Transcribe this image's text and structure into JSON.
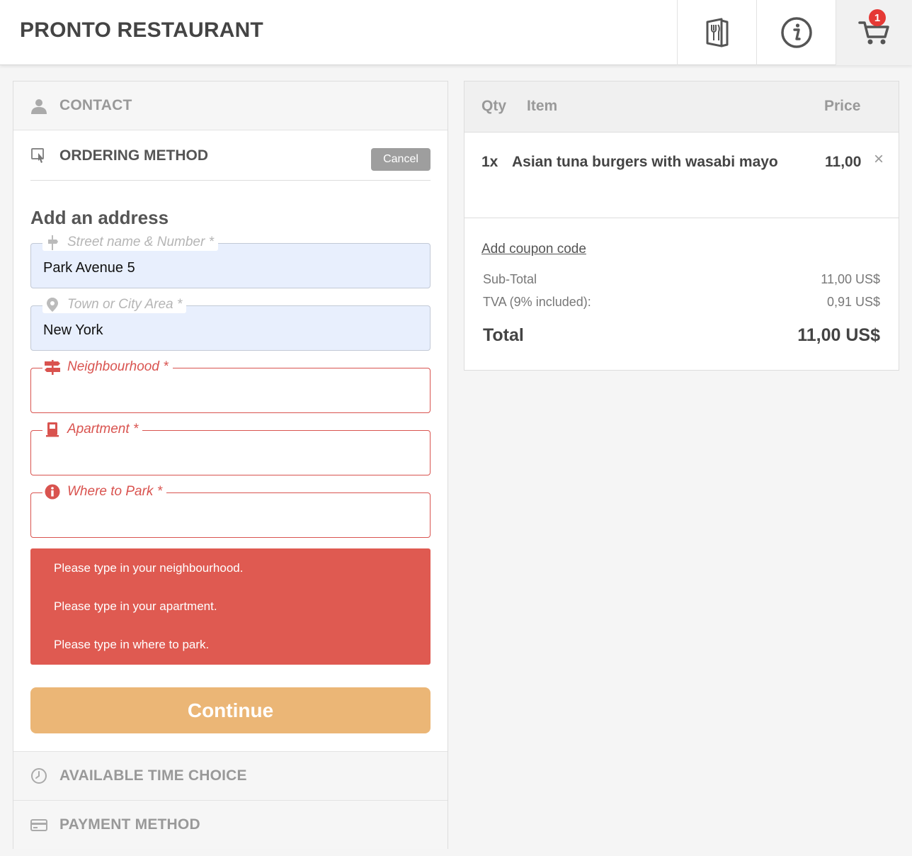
{
  "header": {
    "brand": "PRONTO RESTAURANT",
    "cart_count": "1",
    "icons": [
      "menu-icon",
      "info-icon",
      "cart-icon"
    ]
  },
  "steps": {
    "contact": "CONTACT",
    "ordering_method": "ORDERING METHOD",
    "cancel": "Cancel",
    "time": "AVAILABLE TIME CHOICE",
    "payment": "PAYMENT METHOD"
  },
  "address": {
    "title": "Add an address",
    "street": {
      "label": "Street name & Number *",
      "value": "Park Avenue 5"
    },
    "town": {
      "label": "Town or City Area *",
      "value": "New York"
    },
    "neighbourhood": {
      "label": "Neighbourhood *",
      "value": ""
    },
    "apartment": {
      "label": "Apartment *",
      "value": ""
    },
    "park": {
      "label": "Where to Park *",
      "value": ""
    }
  },
  "errors": [
    "Please type in your neighbourhood.",
    "Please type in your apartment.",
    "Please type in where to park."
  ],
  "continue_label": "Continue",
  "cart": {
    "headers": {
      "qty": "Qty",
      "item": "Item",
      "price": "Price"
    },
    "lines": [
      {
        "qty": "1x",
        "item": "Asian tuna burgers with wasabi mayo",
        "price": "11,00",
        "remove": "×"
      }
    ],
    "coupon": "Add coupon code",
    "subtotal": {
      "label": "Sub-Total",
      "value": "11,00 US$"
    },
    "tax": {
      "label": "TVA (9% included):",
      "value": "0,91 US$"
    },
    "total": {
      "label": "Total",
      "value": "11,00 US$"
    }
  },
  "colors": {
    "error": "#df5a51",
    "continue": "#ebb676",
    "badge": "#e53935",
    "filled_field": "#e8effd"
  }
}
